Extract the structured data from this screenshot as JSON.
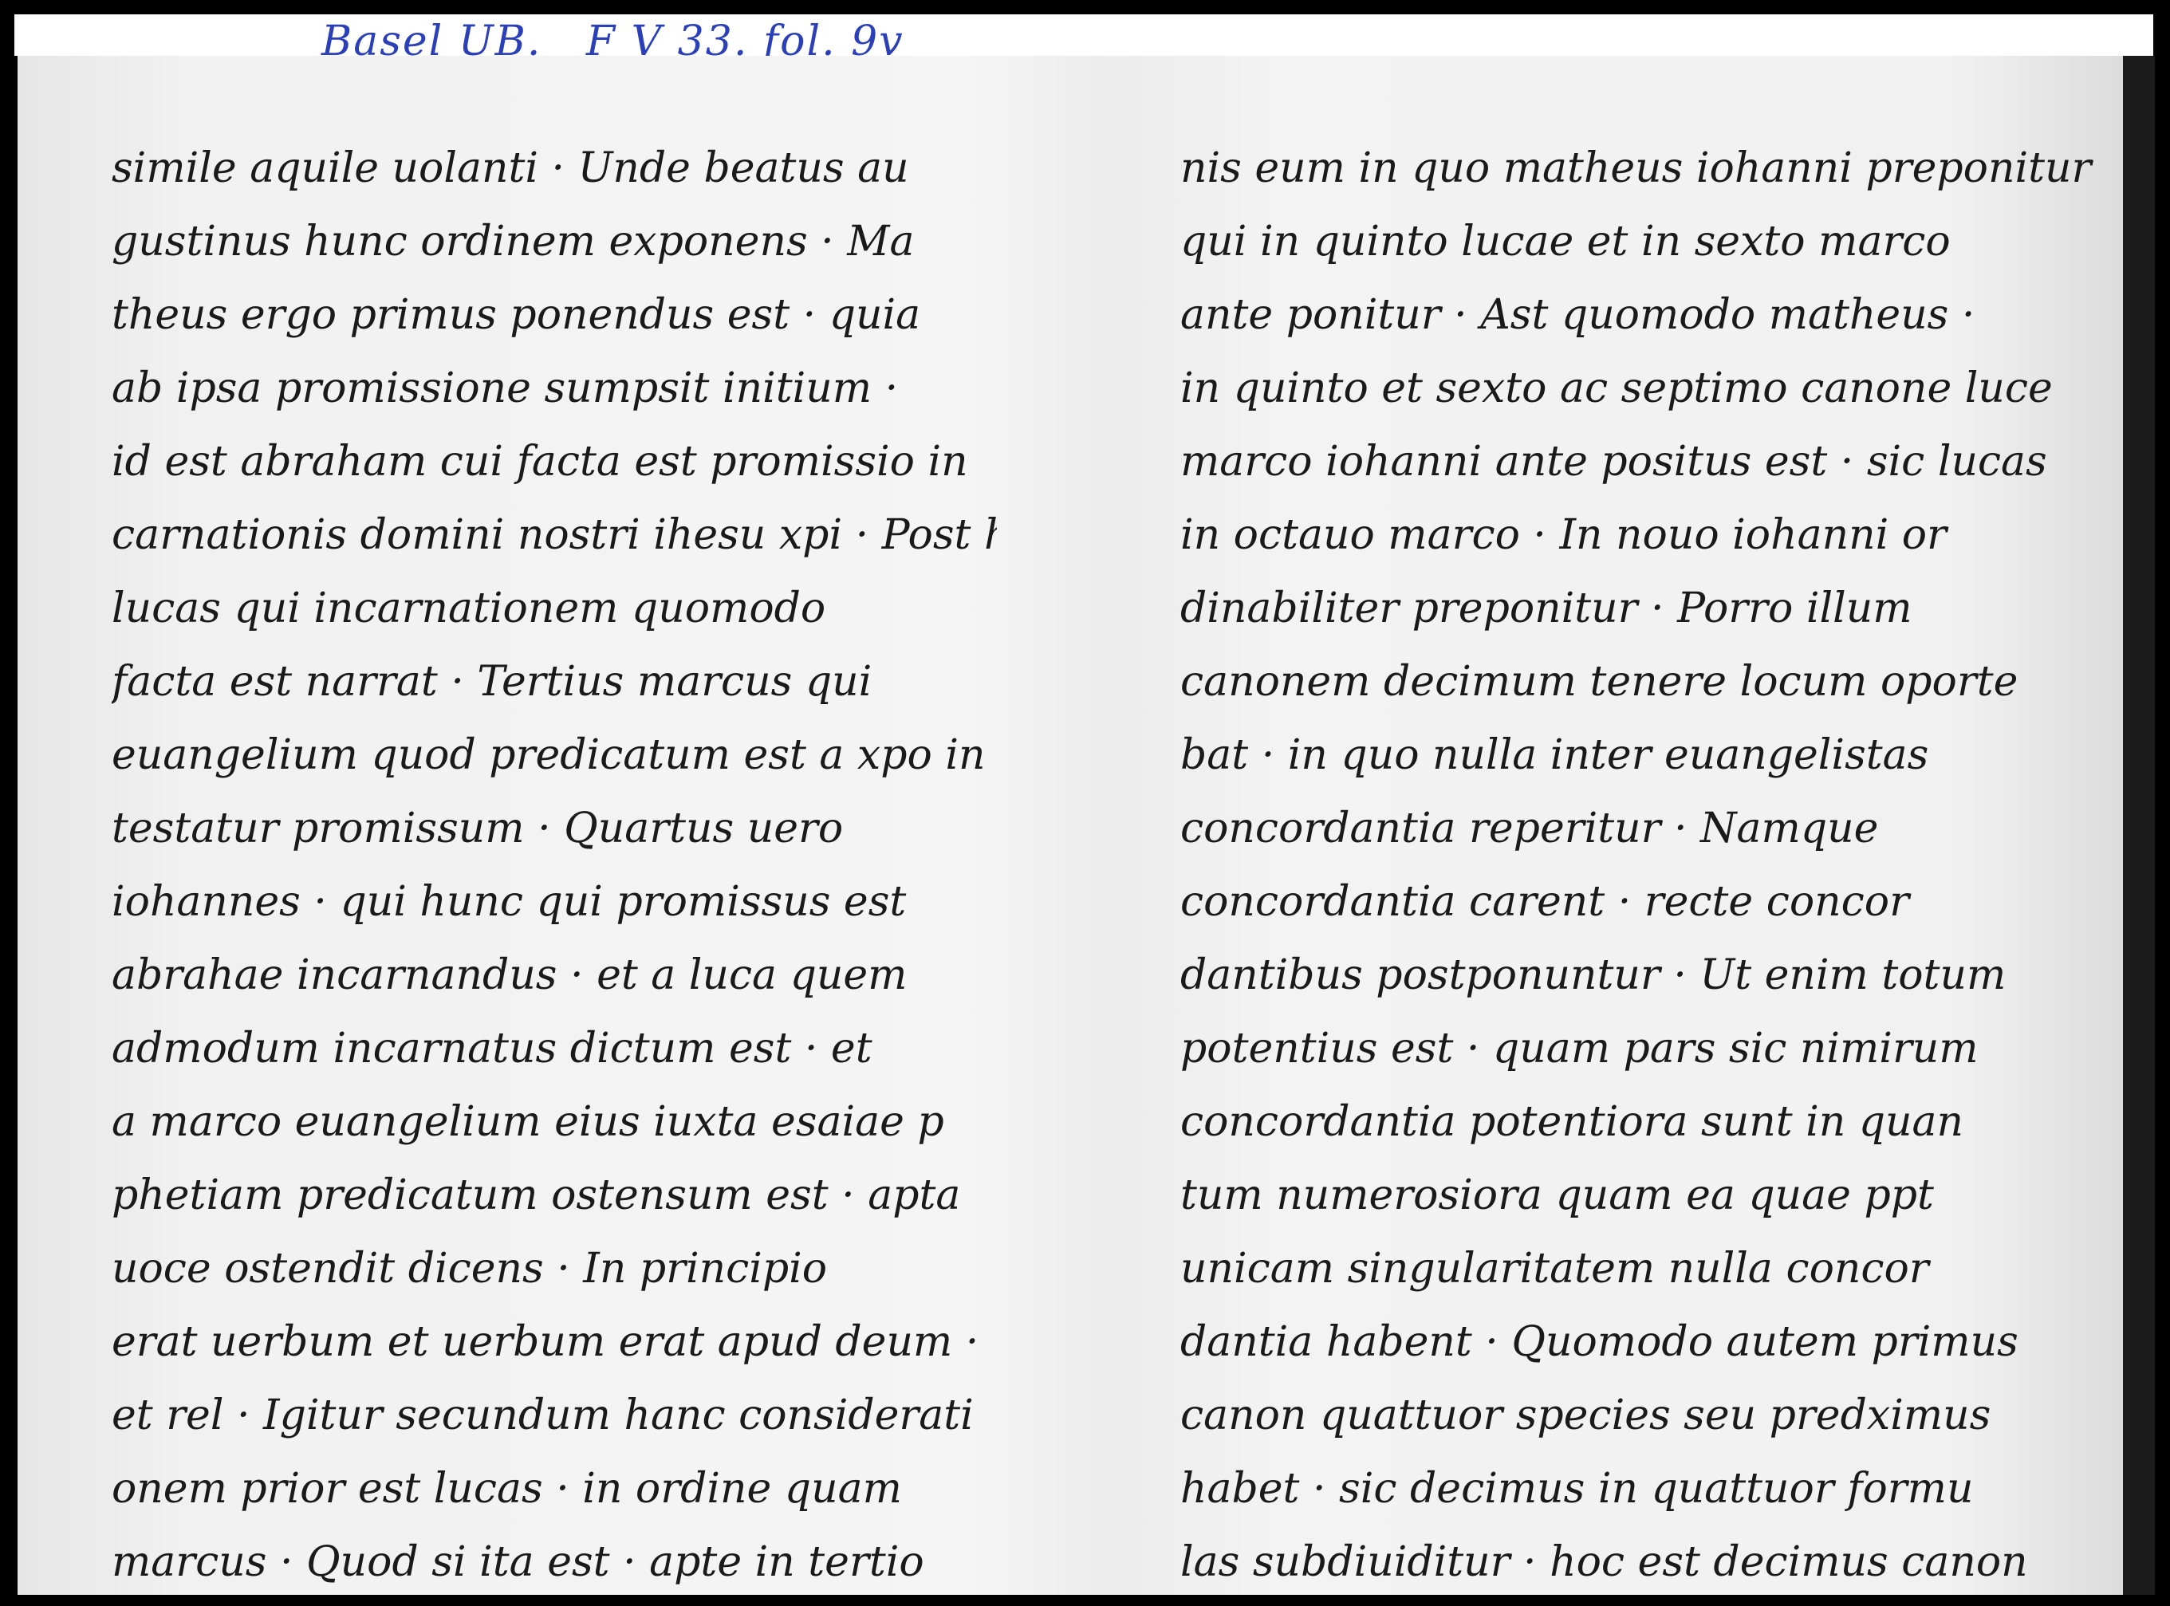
{
  "caption": "Basel UB.   F V 33. fol. 9v",
  "left_column": [
    "simile aquile uolanti · Unde beatus au",
    "gustinus hunc ordinem exponens · Ma",
    "theus ergo primus ponendus est · quia",
    "ab ipsa promissione sumpsit initium ·",
    "id est abraham cui facta est promissio in",
    "carnationis domini nostri ihesu xpi · Post hunc",
    "lucas qui incarnationem quomodo",
    "facta est narrat · Tertius marcus qui",
    "euangelium quod predicatum est a xpo in lege",
    "testatur promissum · Quartus uero",
    "iohannes · qui hunc qui promissus est",
    "abrahae incarnandus · et a luca quem",
    "admodum incarnatus dictum est · et",
    "a marco euangelium eius iuxta esaiae p",
    "phetiam predicatum ostensum est · apta",
    "uoce ostendit dicens · In principio",
    "erat uerbum et uerbum erat apud deum ·",
    "et rel · Igitur secundum hanc considerati",
    "onem prior est lucas · in ordine quam",
    "marcus · Quod si ita est · apte in tertio"
  ],
  "right_column": [
    "nis eum in quo matheus iohanni preponitur",
    "qui in quinto lucae et in sexto marco",
    "ante ponitur · Ast quomodo matheus ·",
    "in quinto et sexto ac septimo canone luce",
    "marco iohanni ante positus est · sic lucas",
    "in octauo marco · In nouo iohanni or",
    "dinabiliter preponitur · Porro illum",
    "canonem decimum tenere locum oporte",
    "bat · in quo nulla inter euangelistas",
    "concordantia reperitur · Namque",
    "concordantia carent · recte concor",
    "dantibus postponuntur · Ut enim totum",
    "potentius est · quam pars sic nimirum",
    "concordantia potentiora sunt in quan",
    "tum numerosiora quam ea quae ppt",
    "unicam singularitatem nulla concor",
    "dantia habent · Quomodo autem primus",
    "canon quattuor species seu predximus",
    "habet · sic decimus in quattuor formu",
    "las subdiuiditur · hoc est decimus canon"
  ]
}
